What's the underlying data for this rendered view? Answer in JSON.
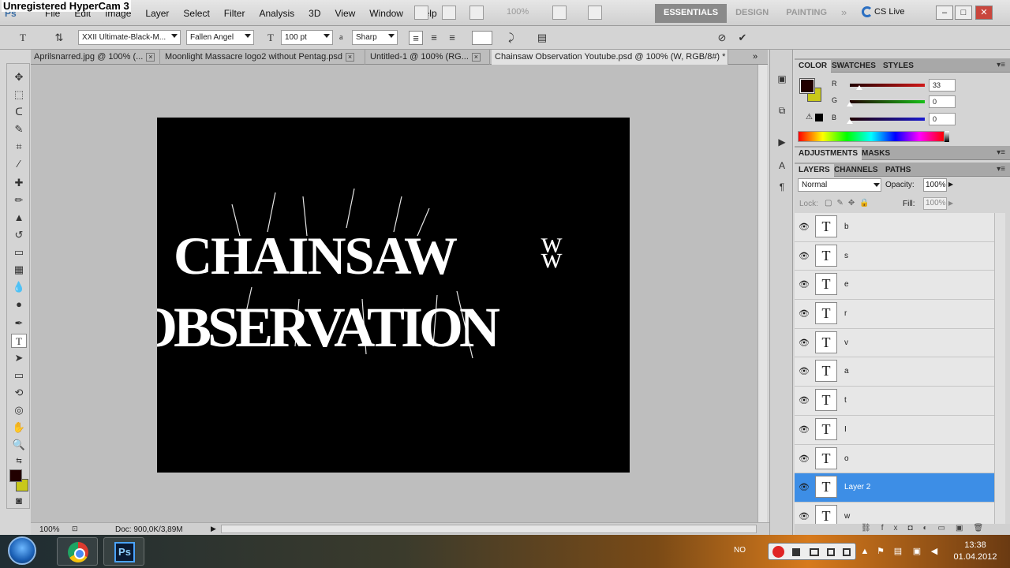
{
  "watermark": "Unregistered HyperCam 3",
  "menubar": {
    "app_icon": "Ps",
    "menus": [
      "File",
      "Edit",
      "Image",
      "Layer",
      "Select",
      "Filter",
      "Analysis",
      "3D",
      "View",
      "Window",
      "Help"
    ],
    "zoom_level": "100%",
    "workspaces": [
      "ESSENTIALS",
      "DESIGN",
      "PAINTING"
    ],
    "more": "»",
    "cs_live": "CS Live",
    "window_buttons": [
      "–",
      "□",
      "✕"
    ]
  },
  "options_bar": {
    "tool_glyph": "T",
    "font_family": "XXII Ultimate-Black-M...",
    "font_style": "Fallen Angel",
    "font_size": "100 pt",
    "aa_label": "a",
    "antialias": "Sharp"
  },
  "tabs": [
    {
      "label": "Aprilsnarred.jpg @ 100% (...",
      "active": false
    },
    {
      "label": "Moonlight Massacre logo2 without Pentag.psd",
      "active": false
    },
    {
      "label": "Untitled-1 @ 100% (RG...",
      "active": false
    },
    {
      "label": "Chainsaw Observation Youtube.psd @ 100% (W, RGB/8#) *",
      "active": true
    }
  ],
  "canvas": {
    "logo_line1": "CHAINSAW",
    "logo_line2": "OBSERVATION",
    "glyph": "ʬ"
  },
  "status": {
    "zoom": "100%",
    "doc_info": "Doc: 900,0K/3,89M"
  },
  "color_panel": {
    "tabs": [
      "COLOR",
      "SWATCHES",
      "STYLES"
    ],
    "channels": [
      {
        "label": "R",
        "value": "33",
        "fraction": 0.13,
        "color": "#d01818"
      },
      {
        "label": "G",
        "value": "0",
        "fraction": 0.0,
        "color": "#18c018"
      },
      {
        "label": "B",
        "value": "0",
        "fraction": 0.0,
        "color": "#1a1ad0"
      }
    ],
    "fg_color": "#210000",
    "bg_color": "#c8c81a"
  },
  "adjust_panel": {
    "tabs": [
      "ADJUSTMENTS",
      "MASKS"
    ]
  },
  "layers_panel": {
    "tabs": [
      "LAYERS",
      "CHANNELS",
      "PATHS"
    ],
    "blend_mode": "Normal",
    "opacity_label": "Opacity:",
    "opacity": "100%",
    "lock_label": "Lock:",
    "fill_label": "Fill:",
    "fill": "100%",
    "layers": [
      {
        "name": "b",
        "thumb": "T",
        "selected": false
      },
      {
        "name": "s",
        "thumb": "T",
        "selected": false
      },
      {
        "name": "e",
        "thumb": "T",
        "selected": false
      },
      {
        "name": "r",
        "thumb": "T",
        "selected": false
      },
      {
        "name": "v",
        "thumb": "T",
        "selected": false
      },
      {
        "name": "a",
        "thumb": "T",
        "selected": false
      },
      {
        "name": "t",
        "thumb": "T",
        "selected": false
      },
      {
        "name": "I",
        "thumb": "T",
        "selected": false
      },
      {
        "name": "o",
        "thumb": "T",
        "selected": false
      },
      {
        "name": "Layer 2",
        "thumb": "T",
        "selected": true
      },
      {
        "name": "w",
        "thumb": "T",
        "selected": false
      }
    ]
  },
  "taskbar": {
    "apps": [
      "chrome",
      "photoshop"
    ],
    "ps_label": "Ps",
    "language": "NO",
    "time": "13:38",
    "date": "01.04.2012"
  }
}
